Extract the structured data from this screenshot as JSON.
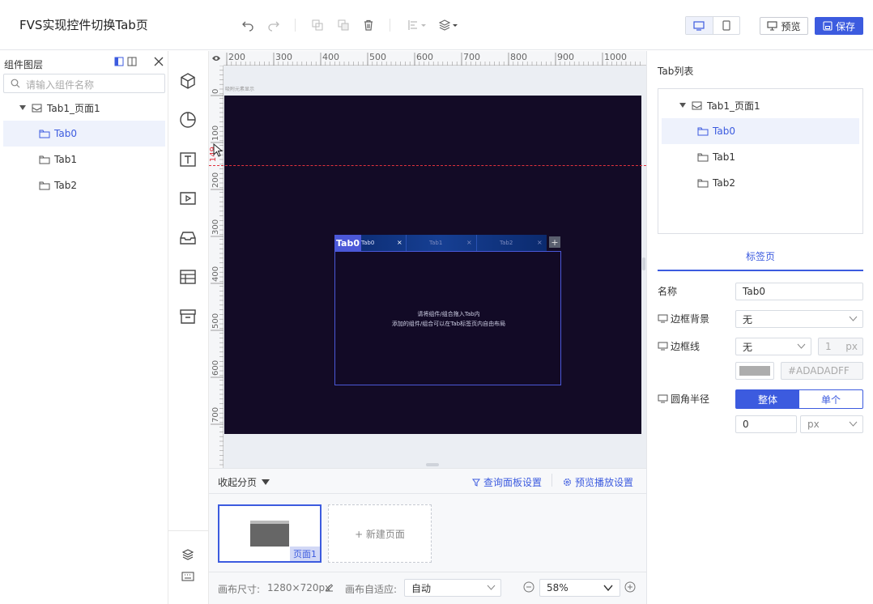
{
  "app": {
    "title": "FVS实现控件切换Tab页"
  },
  "toolbar": {
    "icons": [
      "undo-icon",
      "redo-icon",
      "copy-icon",
      "paste-icon",
      "delete-icon",
      "align-icon",
      "layer-order-icon"
    ],
    "preview_label": "预览",
    "save_label": "保存"
  },
  "layers": {
    "title": "组件图层",
    "search_placeholder": "请输入组件名称",
    "items": [
      {
        "label": "Tab1_页面1"
      },
      {
        "label": "Tab0"
      },
      {
        "label": "Tab1"
      },
      {
        "label": "Tab2"
      }
    ]
  },
  "tools": [
    "3d-cube-icon",
    "pie-chart-icon",
    "text-icon",
    "media-icon",
    "inbox-icon",
    "table-icon",
    "archive-icon",
    "layers-icon",
    "keyboard-icon"
  ],
  "rulers": {
    "top": [
      "200",
      "300",
      "400",
      "500",
      "600",
      "700",
      "800",
      "900",
      "1000"
    ],
    "left": [
      "0",
      "100",
      "200",
      "300",
      "400",
      "500",
      "600",
      "700"
    ],
    "marker": "149",
    "corner_hint": "吸附元素显示"
  },
  "tab_widget": {
    "active_badge": "Tab0",
    "tabs": [
      {
        "label": "Tab0"
      },
      {
        "label": "Tab1"
      },
      {
        "label": "Tab2"
      }
    ],
    "add": "+",
    "close": "×",
    "hint_line1": "请将组件/组合拖入Tab内",
    "hint_line2": "添加的组件/组合可以在Tab标签页内自由布局"
  },
  "pages_panel": {
    "collapse_label": "收起分页",
    "query_panel_label": "查询面板设置",
    "preview_play_label": "预览播放设置",
    "page_badge": "页面1",
    "new_page_label": "+ 新建页面"
  },
  "status": {
    "canvas_size_label": "画布尺寸:",
    "canvas_size_value": "1280×720px",
    "adapt_label": "画布自适应:",
    "adapt_value": "自动",
    "zoom_value": "58%"
  },
  "right_panel": {
    "tab_list_title": "Tab列表",
    "tree": [
      {
        "label": "Tab1_页面1"
      },
      {
        "label": "Tab0"
      },
      {
        "label": "Tab1"
      },
      {
        "label": "Tab2"
      }
    ],
    "section_title": "标签页",
    "name_label": "名称",
    "name_value": "Tab0",
    "border_bg_label": "边框背景",
    "border_bg_value": "无",
    "border_line_label": "边框线",
    "border_line_value": "无",
    "border_width_value": "1",
    "border_width_unit": "px",
    "border_color_value": "#ADADADFF",
    "radius_label": "圆角半径",
    "radius_modes": [
      "整体",
      "单个"
    ],
    "radius_value": "0",
    "radius_unit": "px"
  },
  "colors": {
    "accent": "#3C5BDF",
    "canvas_bg": "#130B26",
    "tab_badge": "#4B58D8",
    "guide_line": "#E0313C",
    "swatch": "#ADADAD"
  }
}
